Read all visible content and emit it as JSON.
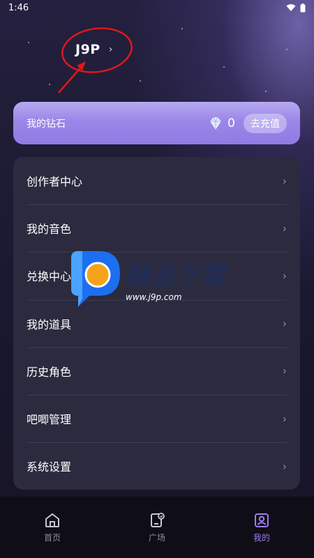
{
  "status_bar": {
    "time": "1:46"
  },
  "profile": {
    "username": "J9P",
    "chevron": "›"
  },
  "diamond_card": {
    "label": "我的钻石",
    "count": "0",
    "recharge_label": "去充值",
    "icon": "diamond-icon"
  },
  "menu": {
    "items": [
      {
        "label": "创作者中心"
      },
      {
        "label": "我的音色"
      },
      {
        "label": "兑换中心"
      },
      {
        "label": "我的道具"
      },
      {
        "label": "历史角色"
      },
      {
        "label": "吧唧管理"
      },
      {
        "label": "系统设置"
      }
    ],
    "chevron": "›"
  },
  "watermark": {
    "title": "精品下载",
    "url": "www.j9p.com"
  },
  "bottom_nav": {
    "items": [
      {
        "label": "首页",
        "icon": "home-icon"
      },
      {
        "label": "广场",
        "icon": "plaza-icon"
      },
      {
        "label": "我的",
        "icon": "profile-icon"
      }
    ],
    "active_color": "#9d7cf2"
  },
  "colors": {
    "accent": "#9d7cf2",
    "annotation": "#e01818",
    "card": "#2b2a3f"
  }
}
